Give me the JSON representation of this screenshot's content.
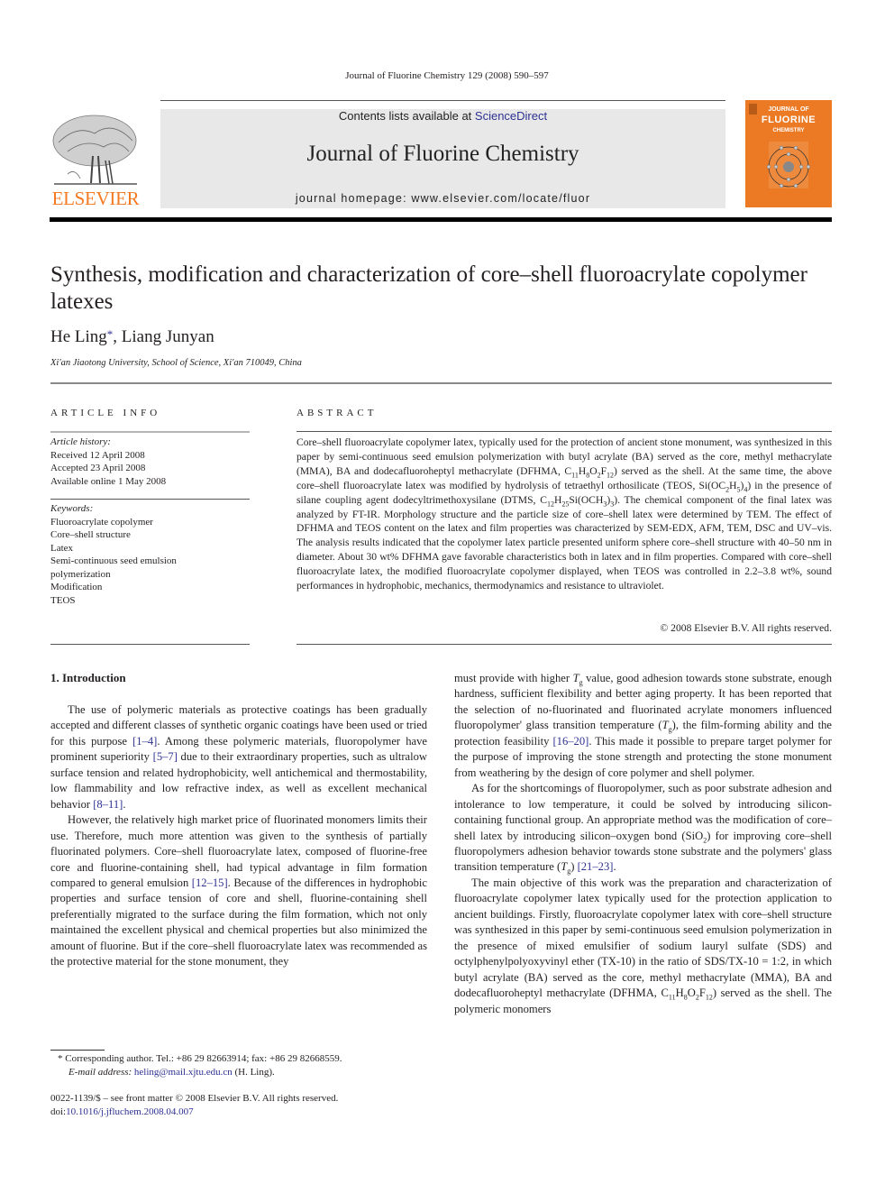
{
  "header": {
    "journal_reference": "Journal of Fluorine Chemistry 129 (2008) 590–597",
    "contents_prefix": "Contents lists available at ",
    "contents_link": "ScienceDirect",
    "journal_name": "Journal of Fluorine Chemistry",
    "homepage": "journal homepage: www.elsevier.com/locate/fluor",
    "publisher_logo_text": "ELSEVIER",
    "cover_title_lines": [
      "JOURNAL OF",
      "FLUORINE",
      "CHEMISTRY"
    ],
    "brand_orange": "#f47920",
    "cover_orange": "#ec7a25",
    "link_color": "#2e3192"
  },
  "article": {
    "title": "Synthesis, modification and characterization of core–shell fluoroacrylate copolymer latexes",
    "authors": [
      {
        "name": "He Ling",
        "mark": "*"
      },
      {
        "name": "Liang Junyan",
        "mark": ""
      }
    ],
    "author_separator": ", ",
    "affiliation": "Xi'an Jiaotong University, School of Science, Xi'an 710049, China"
  },
  "article_info": {
    "heading": "ARTICLE INFO",
    "history_label": "Article history:",
    "history": [
      "Received 12 April 2008",
      "Accepted 23 April 2008",
      "Available online 1 May 2008"
    ],
    "keywords_label": "Keywords:",
    "keywords": [
      "Fluoroacrylate copolymer",
      "Core–shell structure",
      "Latex",
      "Semi-continuous seed emulsion polymerization",
      "Modification",
      "TEOS"
    ]
  },
  "abstract": {
    "heading": "ABSTRACT",
    "parts": {
      "p1": "Core–shell fluoroacrylate copolymer latex, typically used for the protection of ancient stone monument, was synthesized in this paper by semi-continuous seed emulsion polymerization with butyl acrylate (BA) served as the core, methyl methacrylate (MMA), BA and dodecafluoroheptyl methacrylate (DFHMA, ",
      "f1": [
        "C",
        "11",
        "H",
        "8",
        "O",
        "2",
        "F",
        "12"
      ],
      "p2": ") served as the shell. At the same time, the above core–shell fluoroacrylate latex was modified by hydrolysis of tetraethyl orthosilicate (TEOS, Si(OC",
      "p3": "H",
      "p4": ")",
      "p5": ") in the presence of silane coupling agent dodecyltrimethoxysilane (DTMS, C",
      "p6": "H",
      "p7": "Si(OCH",
      "p8": ")",
      "p9": "). The chemical component of the final latex was analyzed by FT-IR. Morphology structure and the particle size of core–shell latex were determined by TEM. The effect of DFHMA and TEOS content on the latex and film properties was characterized by SEM-EDX, AFM, TEM, DSC and UV–vis. The analysis results indicated that the copolymer latex particle presented uniform sphere core–shell structure with 40–50 nm in diameter. About 30 wt% DFHMA gave favorable characteristics both in latex and in film properties. Compared with core–shell fluoroacrylate latex, the modified fluoroacrylate copolymer displayed, when TEOS was controlled in 2.2–3.8 wt%, sound performances in hydrophobic, mechanics, thermodynamics and resistance to ultraviolet.",
      "s": [
        "2",
        "5",
        "4",
        "12",
        "25",
        "3",
        "3"
      ]
    },
    "copyright": "© 2008 Elsevier B.V. All rights reserved."
  },
  "body": {
    "section_heading": "1.  Introduction",
    "left": {
      "p1a": "The use of polymeric materials as protective coatings has been gradually accepted and different classes of synthetic organic coatings have been used or tried for this purpose ",
      "ref1": "[1–4]",
      "p1b": ". Among these polymeric materials, fluoropolymer have prominent superiority ",
      "ref2": "[5–7]",
      "p1c": " due to their extraordinary properties, such as ultralow surface tension and related hydrophobicity, well antichemical and thermostability, low flammability and low refractive index, as well as excellent mechanical behavior ",
      "ref3": "[8–11]",
      "p1d": ".",
      "p2a": "However, the relatively high market price of fluorinated monomers limits their use. Therefore, much more attention was given to the synthesis of partially fluorinated polymers. Core–shell fluoroacrylate latex, composed of fluorine-free core and fluorine-containing shell, had typical advantage in film formation compared to general emulsion ",
      "ref4": "[12–15]",
      "p2b": ". Because of the differences in hydrophobic properties and surface tension of core and shell, fluorine-containing shell preferentially migrated to the surface during the film formation, which not only maintained the excellent physical and chemical properties but also minimized the amount of fluorine. But if the core–shell fluoroacrylate latex was recommended as the protective material for the stone monument, they"
    },
    "right": {
      "p1a": "must provide with higher ",
      "tg": "T",
      "tg_sub": "g",
      "p1b": " value, good adhesion towards stone substrate, enough hardness, sufficient flexibility and better aging property. It has been reported that the selection of no-fluorinated and fluorinated acrylate monomers influenced fluoropolymer' glass transition temperature (",
      "p1c": "), the film-forming ability and the protection feasibility ",
      "ref5": "[16–20]",
      "p1d": ". This made it possible to prepare target polymer for the purpose of improving the stone strength and protecting the stone monument from weathering by the design of core polymer and shell polymer.",
      "p2a": "As for the shortcomings of fluoropolymer, such as poor substrate adhesion and intolerance to low temperature, it could be solved by introducing silicon-containing functional group. An appropriate method was the modification of core–shell latex by introducing silicon–oxygen bond (SiO",
      "p2b": ") for improving core–shell fluoropolymers adhesion behavior towards stone substrate and the polymers' glass transition temperature (",
      "p2c": ") ",
      "ref6": "[21–23]",
      "p2d": ".",
      "p3a": "The main objective of this work was the preparation and characterization of fluoroacrylate copolymer latex typically used for the protection application to ancient buildings. Firstly, fluoroacrylate copolymer latex with core–shell structure was synthesized in this paper by semi-continuous seed emulsion polymerization in the presence of mixed emulsifier of sodium lauryl sulfate (SDS) and octylphenylpolyoxyvinyl ether (TX-10) in the ratio of SDS/TX-10 = 1:2, in which butyl acrylate (BA) served as the core, methyl methacrylate (MMA), BA and dodecafluoroheptyl methacrylate (DFHMA, C",
      "p3b": "H",
      "p3c": "O",
      "p3d": "F",
      "p3e": ") served as the shell. The polymeric monomers",
      "subs": [
        "2",
        "11",
        "8",
        "2",
        "12"
      ]
    }
  },
  "footnote": {
    "mark": "*",
    "line1": " Corresponding author. Tel.: +86 29 82663914; fax: +86 29 82668559.",
    "email_label": "E-mail address: ",
    "email": "heling@mail.xjtu.edu.cn",
    "email_suffix": " (H. Ling)."
  },
  "front_matter": {
    "issn_line": "0022-1139/$ – see front matter © 2008 Elsevier B.V. All rights reserved.",
    "doi_prefix": "doi:",
    "doi": "10.1016/j.jfluchem.2008.04.007"
  }
}
